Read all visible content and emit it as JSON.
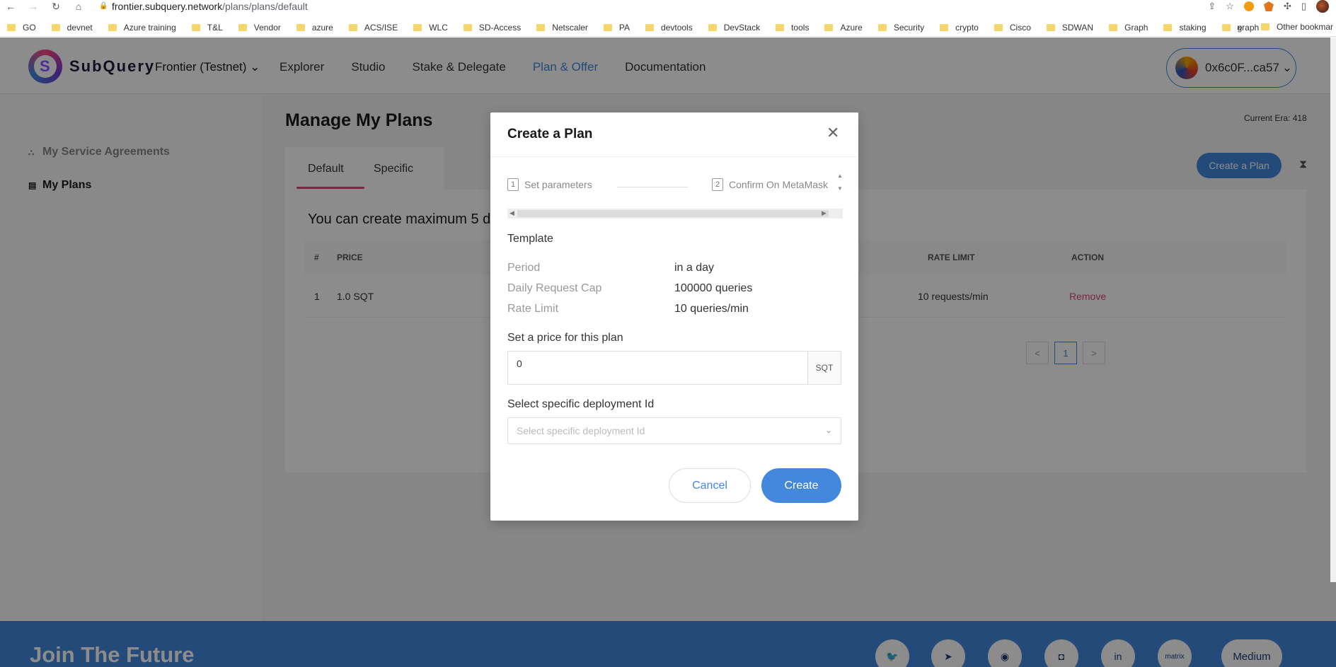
{
  "browser": {
    "url_domain": "frontier.subquery.network",
    "url_path": "/plans/plans/default",
    "bookmarks": [
      "GO",
      "devnet",
      "Azure training",
      "T&L",
      "Vendor",
      "azure",
      "ACS/ISE",
      "WLC",
      "SD-Access",
      "Netscaler",
      "PA",
      "devtools",
      "DevStack",
      "tools",
      "Azure",
      "Security",
      "crypto",
      "Cisco",
      "SDWAN",
      "Graph",
      "staking",
      "graph"
    ],
    "bookmarks_more": "»",
    "other_bookmarks": "Other bookmar"
  },
  "header": {
    "logo_text": "SubQuery",
    "network": "Frontier (Testnet)",
    "nav": [
      "Explorer",
      "Studio",
      "Stake & Delegate",
      "Plan & Offer",
      "Documentation"
    ],
    "active_nav": "Plan & Offer",
    "wallet": "0x6c0F...ca57"
  },
  "sidebar": {
    "items": [
      {
        "label": "My Service Agreements",
        "icon": "sitemap-icon"
      },
      {
        "label": "My Plans",
        "icon": "document-icon"
      }
    ]
  },
  "main": {
    "title": "Manage My Plans",
    "era": "Current Era: 418",
    "tabs": [
      "Default",
      "Specific"
    ],
    "create_button": "Create a Plan",
    "max_text": "You can create maximum 5 d",
    "table": {
      "headers": {
        "num": "#",
        "price": "PRICE",
        "rate_limit": "RATE LIMIT",
        "action": "ACTION"
      },
      "rows": [
        {
          "num": "1",
          "price": "1.0 SQT",
          "rate_limit": "10 requests/min",
          "action": "Remove"
        }
      ]
    },
    "pagination": {
      "prev": "<",
      "current": "1",
      "next": ">"
    }
  },
  "footer": {
    "title": "Join The Future",
    "socials": [
      "twitter-icon",
      "telegram-icon",
      "github-icon",
      "discord-icon",
      "linkedin-icon",
      "matrix",
      "Medium"
    ],
    "matrix_label": "matrix",
    "medium_label": "Medium"
  },
  "modal": {
    "title": "Create a Plan",
    "steps": [
      {
        "num": "1",
        "label": "Set parameters"
      },
      {
        "num": "2",
        "label": "Confirm On MetaMask"
      }
    ],
    "template_label": "Template",
    "template": [
      {
        "key": "Period",
        "value": "in a day"
      },
      {
        "key": "Daily Request Cap",
        "value": "100000 queries"
      },
      {
        "key": "Rate Limit",
        "value": "10 queries/min"
      }
    ],
    "price_label": "Set a price for this plan",
    "price_value": "0",
    "price_unit": "SQT",
    "deployment_label": "Select specific deployment Id",
    "deployment_placeholder": "Select specific deployment Id",
    "cancel": "Cancel",
    "create": "Create"
  },
  "colors": {
    "accent": "#4388dd",
    "pink": "#e0457b",
    "footer": "#4388dd"
  }
}
